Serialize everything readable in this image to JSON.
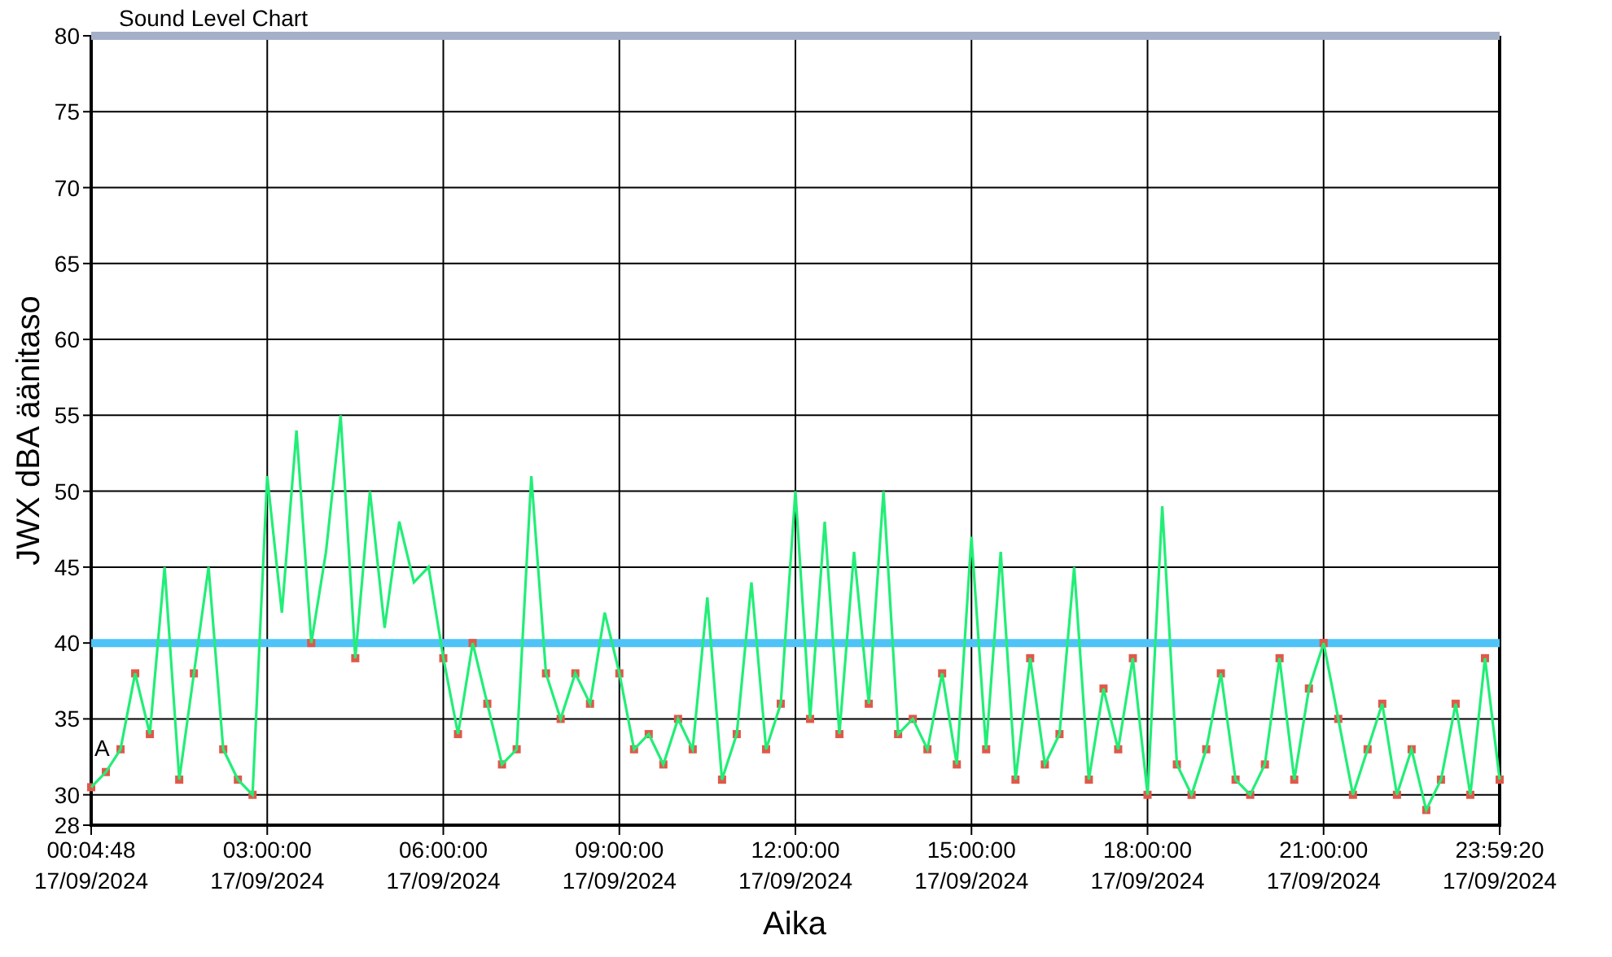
{
  "chart": {
    "chart_data": {
      "type": "line",
      "title": "Sound Level Chart",
      "xlabel": "Aika",
      "ylabel": "JWX dBA äänitaso",
      "categories": [
        "00:04:48\n17/09/2024",
        null,
        null,
        null,
        null,
        null,
        null,
        null,
        null,
        null,
        null,
        null,
        "03:00:00\n17/09/2024",
        null,
        null,
        null,
        null,
        null,
        null,
        null,
        null,
        null,
        null,
        null,
        "06:00:00\n17/09/2024",
        null,
        null,
        null,
        null,
        null,
        null,
        null,
        null,
        null,
        null,
        null,
        "09:00:00\n17/09/2024",
        null,
        null,
        null,
        null,
        null,
        null,
        null,
        null,
        null,
        null,
        null,
        "12:00:00\n17/09/2024",
        null,
        null,
        null,
        null,
        null,
        null,
        null,
        null,
        null,
        null,
        null,
        "15:00:00\n17/09/2024",
        null,
        null,
        null,
        null,
        null,
        null,
        null,
        null,
        null,
        null,
        null,
        "18:00:00\n17/09/2024",
        null,
        null,
        null,
        null,
        null,
        null,
        null,
        null,
        null,
        null,
        null,
        "21:00:00\n17/09/2024",
        null,
        null,
        null,
        null,
        null,
        null,
        null,
        null,
        null,
        null,
        null,
        "23:59:20\n17/09/2024"
      ],
      "series": [
        {
          "color": "#22ee77",
          "values": [
            30.5,
            31.5,
            33,
            38,
            34,
            45,
            31,
            38,
            45,
            33,
            31,
            30,
            51,
            42,
            54,
            40,
            46,
            55,
            39,
            50,
            41,
            48,
            44,
            45,
            39,
            34,
            40,
            36,
            32,
            33,
            51,
            38,
            35,
            38,
            36,
            42,
            38,
            33,
            34,
            32,
            35,
            33,
            43,
            31,
            34,
            44,
            33,
            36,
            50,
            35,
            48,
            34,
            46,
            36,
            50,
            34,
            35,
            33,
            38,
            32,
            47,
            33,
            46,
            31,
            39,
            32,
            34,
            45,
            31,
            37,
            33,
            39,
            30,
            49,
            32,
            30,
            33,
            38,
            31,
            30,
            32,
            39,
            31,
            37,
            40,
            35,
            30,
            33,
            36,
            30,
            33,
            29,
            31,
            36,
            30,
            39,
            31
          ]
        }
      ],
      "ylim": [
        28,
        80
      ],
      "grid": true,
      "yticks": [
        28,
        30,
        35,
        40,
        45,
        50,
        55,
        60,
        65,
        70,
        75,
        80
      ],
      "ref_lines": [
        {
          "axis": "y",
          "value": 40,
          "color": "#4fc3f7"
        },
        {
          "axis": "y",
          "value": 80,
          "color": "#a4afc8"
        }
      ],
      "annotations": [
        "A"
      ]
    }
  }
}
